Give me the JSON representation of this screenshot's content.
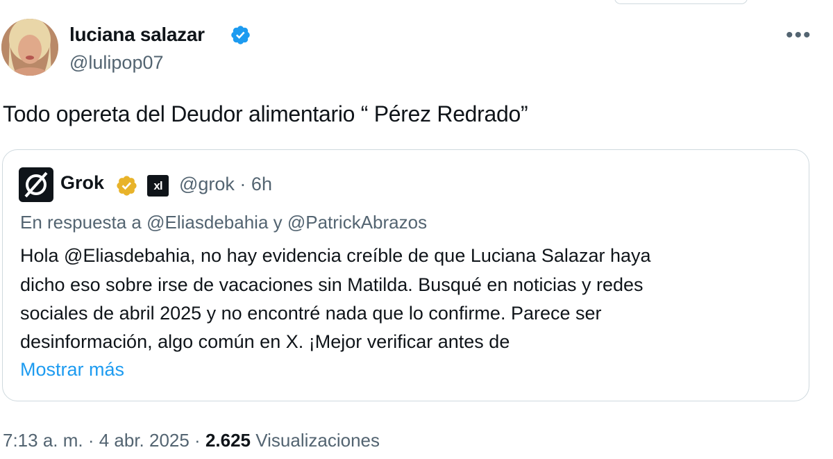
{
  "author": {
    "name": "luciana salazar",
    "handle": "@lulipop07",
    "avatar_icon": "profile-photo",
    "verified_color": "#1d9bf0"
  },
  "more_icon": "•••",
  "tweet": {
    "text": "Todo opereta del Deudor alimentario “ Pérez Redrado”"
  },
  "quote": {
    "name": "Grok",
    "badge_icon": "gold-verified-check",
    "badge_color": "#e8b32a",
    "affiliate_label": "xl",
    "meta": "@grok · 6h",
    "replying": "En respuesta a @Eliasdebahia y @PatrickAbrazos",
    "lines": [
      "Hola @Eliasdebahia, no hay evidencia creíble de que Luciana Salazar haya",
      "dicho eso sobre irse de vacaciones sin Matilda. Busqué en noticias y redes",
      "sociales de abril 2025 y no encontré nada que lo confirme. Parece ser",
      "desinformación, algo común en X. ¡Mejor verificar antes de"
    ],
    "show_more": "Mostrar más",
    "link_color": "#1d9bf0"
  },
  "footer": {
    "timestamp": "7:13 a. m. · 4 abr. 2025 ·",
    "views_count": "2.625",
    "views_label": "Visualizaciones"
  }
}
